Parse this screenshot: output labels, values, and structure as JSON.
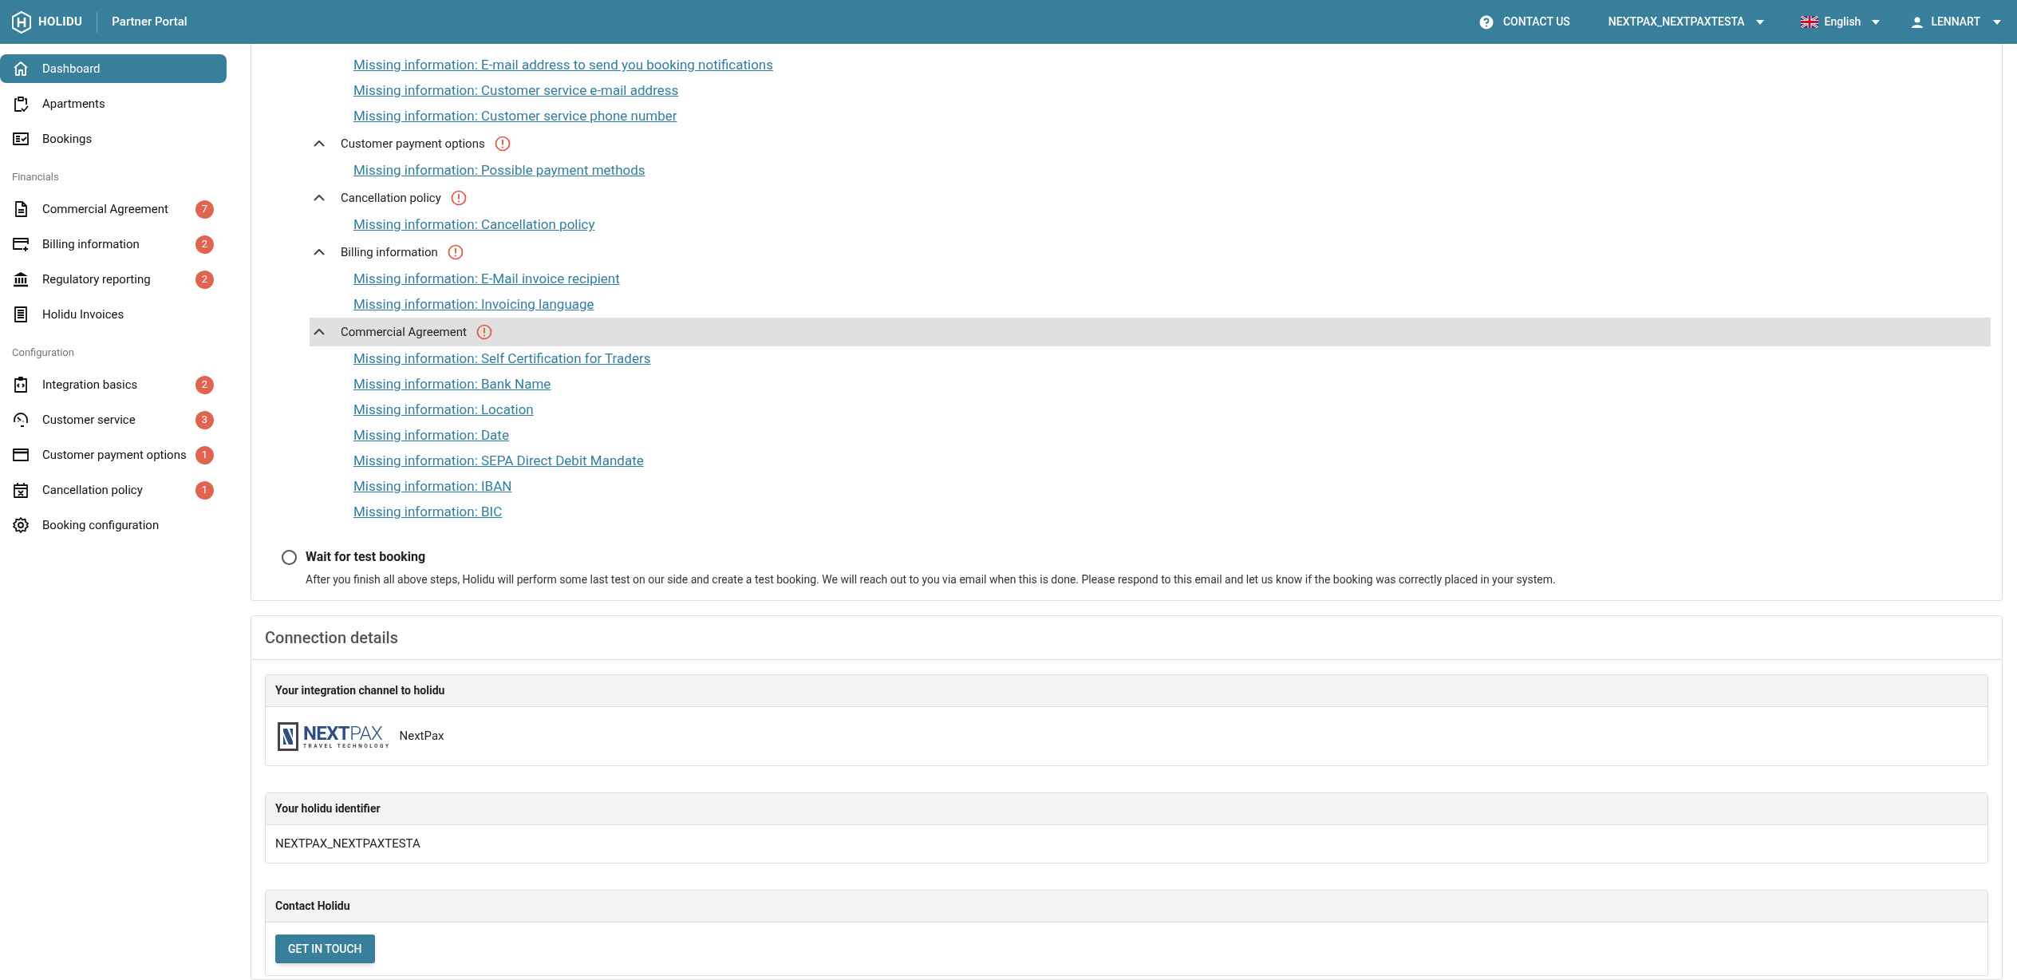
{
  "topbar": {
    "brand": "HOLIDU",
    "portal": "Partner Portal",
    "contact": "CONTACT US",
    "account": "NEXTPAX_NEXTPAXTESTA",
    "language": "English",
    "user": "LENNART"
  },
  "sidebar": {
    "groups": [
      {
        "items": [
          {
            "label": "Dashboard",
            "selected": true
          },
          {
            "label": "Apartments",
            "selected": false
          },
          {
            "label": "Bookings",
            "selected": false
          }
        ]
      },
      {
        "heading": "Financials",
        "items": [
          {
            "label": "Commercial Agreement",
            "selected": false,
            "badge": "7"
          },
          {
            "label": "Billing information",
            "selected": false,
            "badge": "2"
          },
          {
            "label": "Regulatory reporting",
            "selected": false,
            "badge": "2"
          },
          {
            "label": "Holidu Invoices",
            "selected": false
          }
        ]
      },
      {
        "heading": "Configuration",
        "items": [
          {
            "label": "Integration basics",
            "selected": false,
            "badge": "2"
          },
          {
            "label": "Customer service",
            "selected": false,
            "badge": "3"
          },
          {
            "label": "Customer payment options",
            "selected": false,
            "badge": "1"
          },
          {
            "label": "Cancellation policy",
            "selected": false,
            "badge": "1"
          },
          {
            "label": "Booking configuration",
            "selected": false
          }
        ]
      }
    ]
  },
  "checklist": {
    "sections": [
      {
        "missing": [
          "Missing information: E-mail address to send you booking notifications",
          "Missing information: Customer service e-mail address",
          "Missing information: Customer service phone number"
        ]
      },
      {
        "title": "Customer payment options",
        "expanded": true,
        "missing": [
          "Missing information: Possible payment methods"
        ]
      },
      {
        "title": "Cancellation policy",
        "expanded": true,
        "missing": [
          "Missing information: Cancellation policy"
        ]
      },
      {
        "title": "Billing information",
        "expanded": true,
        "missing": [
          "Missing information: E-Mail invoice recipient",
          "Missing information: Invoicing language"
        ]
      },
      {
        "title": "Commercial Agreement",
        "expanded": true,
        "highlighted": true,
        "missing": [
          "Missing information: Self Certification for Traders",
          "Missing information: Bank Name",
          "Missing information: Location",
          "Missing information: Date",
          "Missing information: SEPA Direct Debit Mandate",
          "Missing information: IBAN",
          "Missing information: BIC"
        ]
      }
    ],
    "step": {
      "title": "Wait for test booking",
      "description": "After you finish all above steps, Holidu will perform some last test on our side and create a test booking. We will reach out to you via email when this is done. Please respond to this email and let us know if the booking was correctly placed in your system.",
      "done": false
    }
  },
  "connection": {
    "title": "Connection details",
    "panels": [
      {
        "kind": "logo",
        "heading": "Your integration channel to holidu",
        "logo_bold": "NEXT",
        "logo_light": "PAX",
        "logo_tagline": "TRAVEL TECHNOLOGY",
        "name": "NextPax"
      },
      {
        "kind": "text",
        "heading": "Your holidu identifier",
        "value": "NEXTPAX_NEXTPAXTESTA"
      },
      {
        "kind": "button",
        "heading": "Contact Holidu",
        "button": "GET IN TOUCH"
      }
    ]
  }
}
